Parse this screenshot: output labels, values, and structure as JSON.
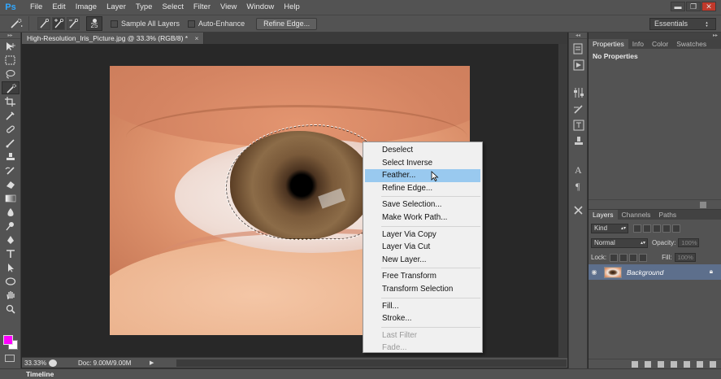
{
  "menubar": {
    "logo": "Ps",
    "items": [
      "File",
      "Edit",
      "Image",
      "Layer",
      "Type",
      "Select",
      "Filter",
      "View",
      "Window",
      "Help"
    ],
    "window_buttons": [
      "▬",
      "❐",
      "✕"
    ]
  },
  "options": {
    "brush_size": "25",
    "sample_all_layers": "Sample All Layers",
    "auto_enhance": "Auto-Enhance",
    "refine_edge_button": "Refine Edge...",
    "workspace": "Essentials"
  },
  "document": {
    "tab_title": "High-Resolution_Iris_Picture.jpg @ 33.3% (RGB/8)",
    "tab_modified": "*",
    "tab_close": "×"
  },
  "context_menu": {
    "groups": [
      [
        "Deselect",
        "Select Inverse",
        "Feather...",
        "Refine Edge..."
      ],
      [
        "Save Selection...",
        "Make Work Path..."
      ],
      [
        "Layer Via Copy",
        "Layer Via Cut",
        "New Layer..."
      ],
      [
        "Free Transform",
        "Transform Selection"
      ],
      [
        "Fill...",
        "Stroke..."
      ],
      [
        "Last Filter",
        "Fade..."
      ]
    ],
    "hovered": "Feather...",
    "disabled": [
      "Last Filter",
      "Fade..."
    ]
  },
  "status": {
    "zoom": "33.33%",
    "doc_info": "Doc: 9.00M/9.00M",
    "arrow": "▶"
  },
  "timeline": {
    "label": "Timeline"
  },
  "properties_panel": {
    "tabs": [
      "Properties",
      "Info",
      "Color",
      "Swatches"
    ],
    "active_tab": "Properties",
    "content": "No Properties"
  },
  "layers_panel": {
    "tabs": [
      "Layers",
      "Channels",
      "Paths"
    ],
    "active_tab": "Layers",
    "filter_kind": "Kind",
    "blend_mode": "Normal",
    "opacity_label": "Opacity:",
    "opacity_value": "100%",
    "lock_label": "Lock:",
    "fill_label": "Fill:",
    "fill_value": "100%",
    "layer_name": "Background"
  },
  "colors": {
    "foreground": "#ff00ff",
    "background": "#ffffff",
    "menu_hover": "#99c9ef"
  }
}
